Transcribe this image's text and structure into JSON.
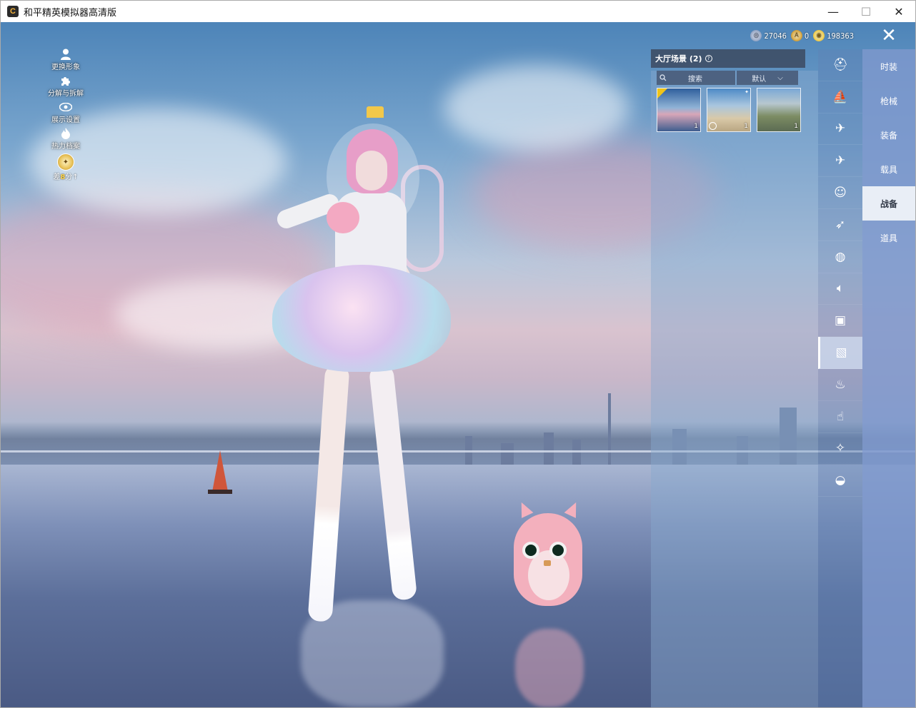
{
  "window": {
    "title": "和平精英模拟器高清版",
    "app_icon_glyph": "C",
    "minimize_icon": "—",
    "maximize_icon": "☐",
    "close_icon": "✕"
  },
  "left_menu": {
    "items": [
      {
        "label": "更换形象",
        "icon": "person-icon"
      },
      {
        "label": "分解与拆解",
        "icon": "puzzle-icon"
      },
      {
        "label": "展示设置",
        "icon": "eye-icon"
      },
      {
        "label": "热力档案",
        "icon": "flame-icon"
      }
    ],
    "score_prefix": "差",
    "score_value": "8",
    "score_suffix": "分"
  },
  "currency": [
    {
      "value": "27046",
      "icon": "silver-coin-icon"
    },
    {
      "value": "0",
      "icon": "gold-medal-icon"
    },
    {
      "value": "198363",
      "icon": "coin-icon"
    }
  ],
  "scene_panel": {
    "title": "大厅场景 (2)",
    "search_label": "搜索",
    "sort_label": "默认",
    "thumbs": [
      {
        "count": "1",
        "selected": true
      },
      {
        "count": "1",
        "timed": true
      },
      {
        "count": "1"
      }
    ]
  },
  "category_icons": [
    "helmet-icon",
    "boat-icon",
    "drone-icon",
    "plane-icon",
    "emoji-icon",
    "glider-icon",
    "backpack-icon",
    "speaker-icon",
    "chat-icon",
    "picture-icon",
    "extinguisher-icon",
    "hand-icon",
    "wand-icon",
    "ufo-icon"
  ],
  "tabs": [
    {
      "label": "时装"
    },
    {
      "label": "枪械"
    },
    {
      "label": "装备"
    },
    {
      "label": "载具"
    },
    {
      "label": "战备",
      "active": true
    },
    {
      "label": "道具"
    }
  ],
  "colors": {
    "tab_bg": "#7c98cd",
    "tab_active": "#e9eef6",
    "accent_gold": "#f0c419"
  }
}
